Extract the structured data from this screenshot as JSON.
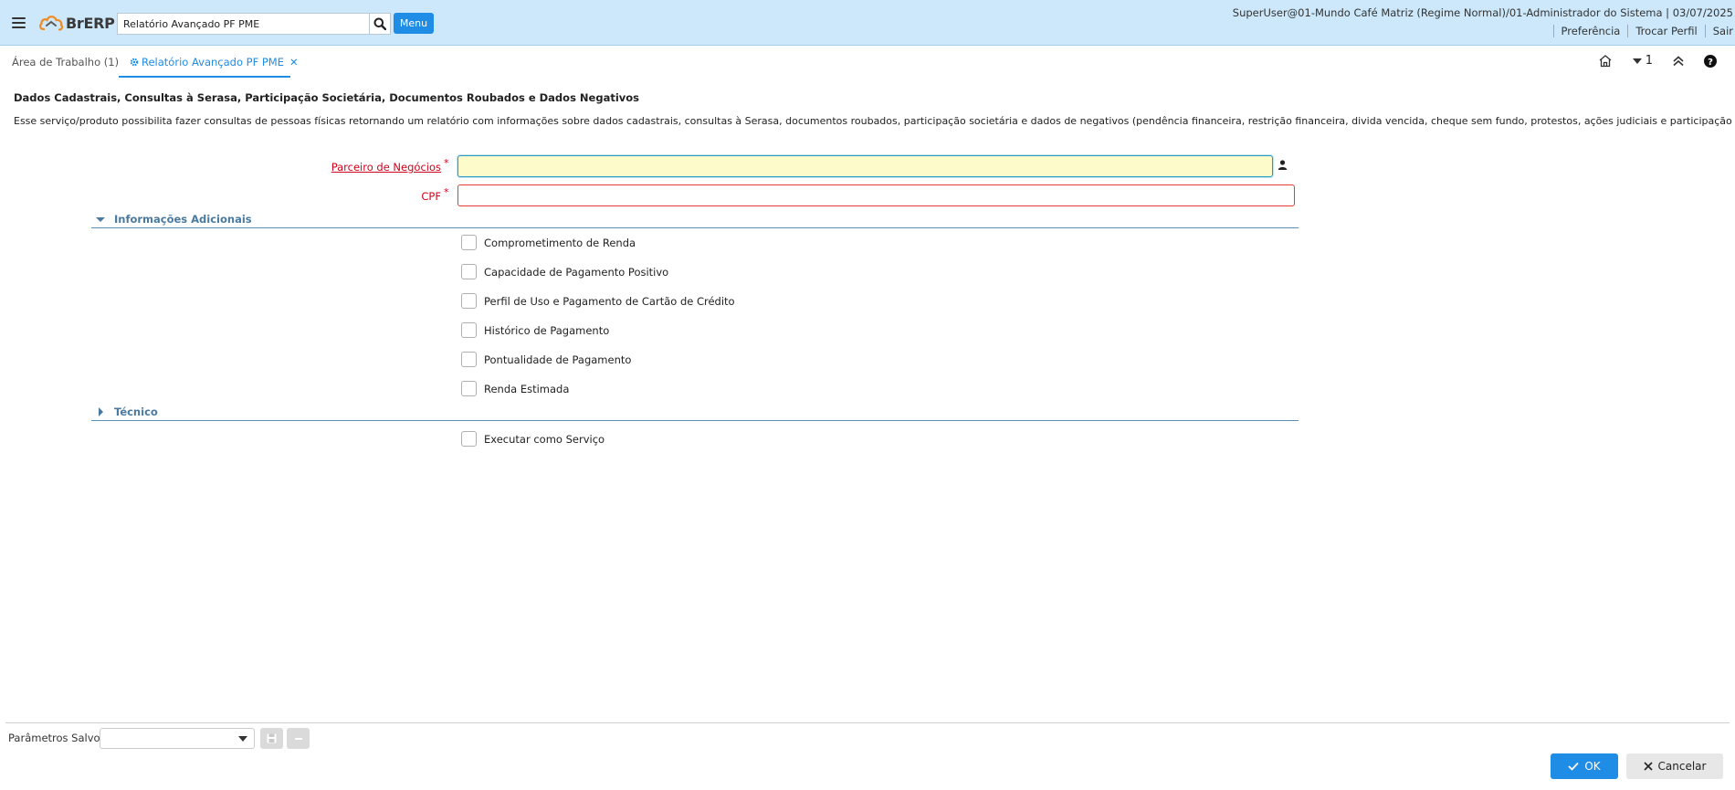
{
  "header": {
    "logo_text": "BrERP",
    "search_value": "Relatório Avançado PF PME",
    "menu_label": "Menu",
    "user_info": "SuperUser@01-Mundo Café Matriz (Regime Normal)/01-Administrador do Sistema | 03/07/2025",
    "links": [
      "Preferência",
      "Trocar Perfil",
      "Sair"
    ]
  },
  "tabs": {
    "work": "Área de Trabalho (1)",
    "active": "Relatório Avançado PF PME",
    "close_glyph": "✕",
    "window_count": "1"
  },
  "content": {
    "title": "Dados Cadastrais, Consultas à Serasa, Participação Societária, Documentos Roubados e Dados Negativos",
    "description": "Esse serviço/produto possibilita fazer consultas de pessoas físicas retornando um relatório com informações sobre dados cadastrais, consultas à Serasa, documentos roubados, participação societária e dados de negativos (pendência financeira, restrição financeira, divida vencida, cheque sem fundo, protestos, ações judiciais e participação em falência).",
    "fields": {
      "partner_label": "Parceiro de Negócios",
      "partner_value": "",
      "cpf_label": "CPF",
      "cpf_value": "",
      "required_mark": "*"
    },
    "sections": {
      "additional": "Informações Adicionais",
      "technical": "Técnico"
    },
    "checkboxes": [
      "Comprometimento de Renda",
      "Capacidade de Pagamento Positivo",
      "Perfil de Uso e Pagamento de Cartão de Crédito",
      "Histórico de Pagamento",
      "Pontualidade de Pagamento",
      "Renda Estimada"
    ],
    "technical_checkbox": "Executar como Serviço"
  },
  "footer": {
    "saved_label": "Parâmetros Salvos",
    "saved_value": "",
    "ok_label": "OK",
    "cancel_label": "Cancelar"
  },
  "colors": {
    "header_bg": "#cce8fa",
    "accent": "#1f8ce5",
    "required": "#d0021b",
    "mandatory_field_bg": "#fdfbc9"
  },
  "icons": {
    "hamburger": "hamburger-icon",
    "search": "search-icon",
    "gear": "gear-icon",
    "home": "home-icon",
    "caret": "caret-down-icon",
    "collapse": "double-chevron-up-icon",
    "help": "help-icon",
    "person": "person-icon",
    "save": "save-icon",
    "delete": "minus-icon",
    "check": "check-icon",
    "close": "close-icon"
  }
}
